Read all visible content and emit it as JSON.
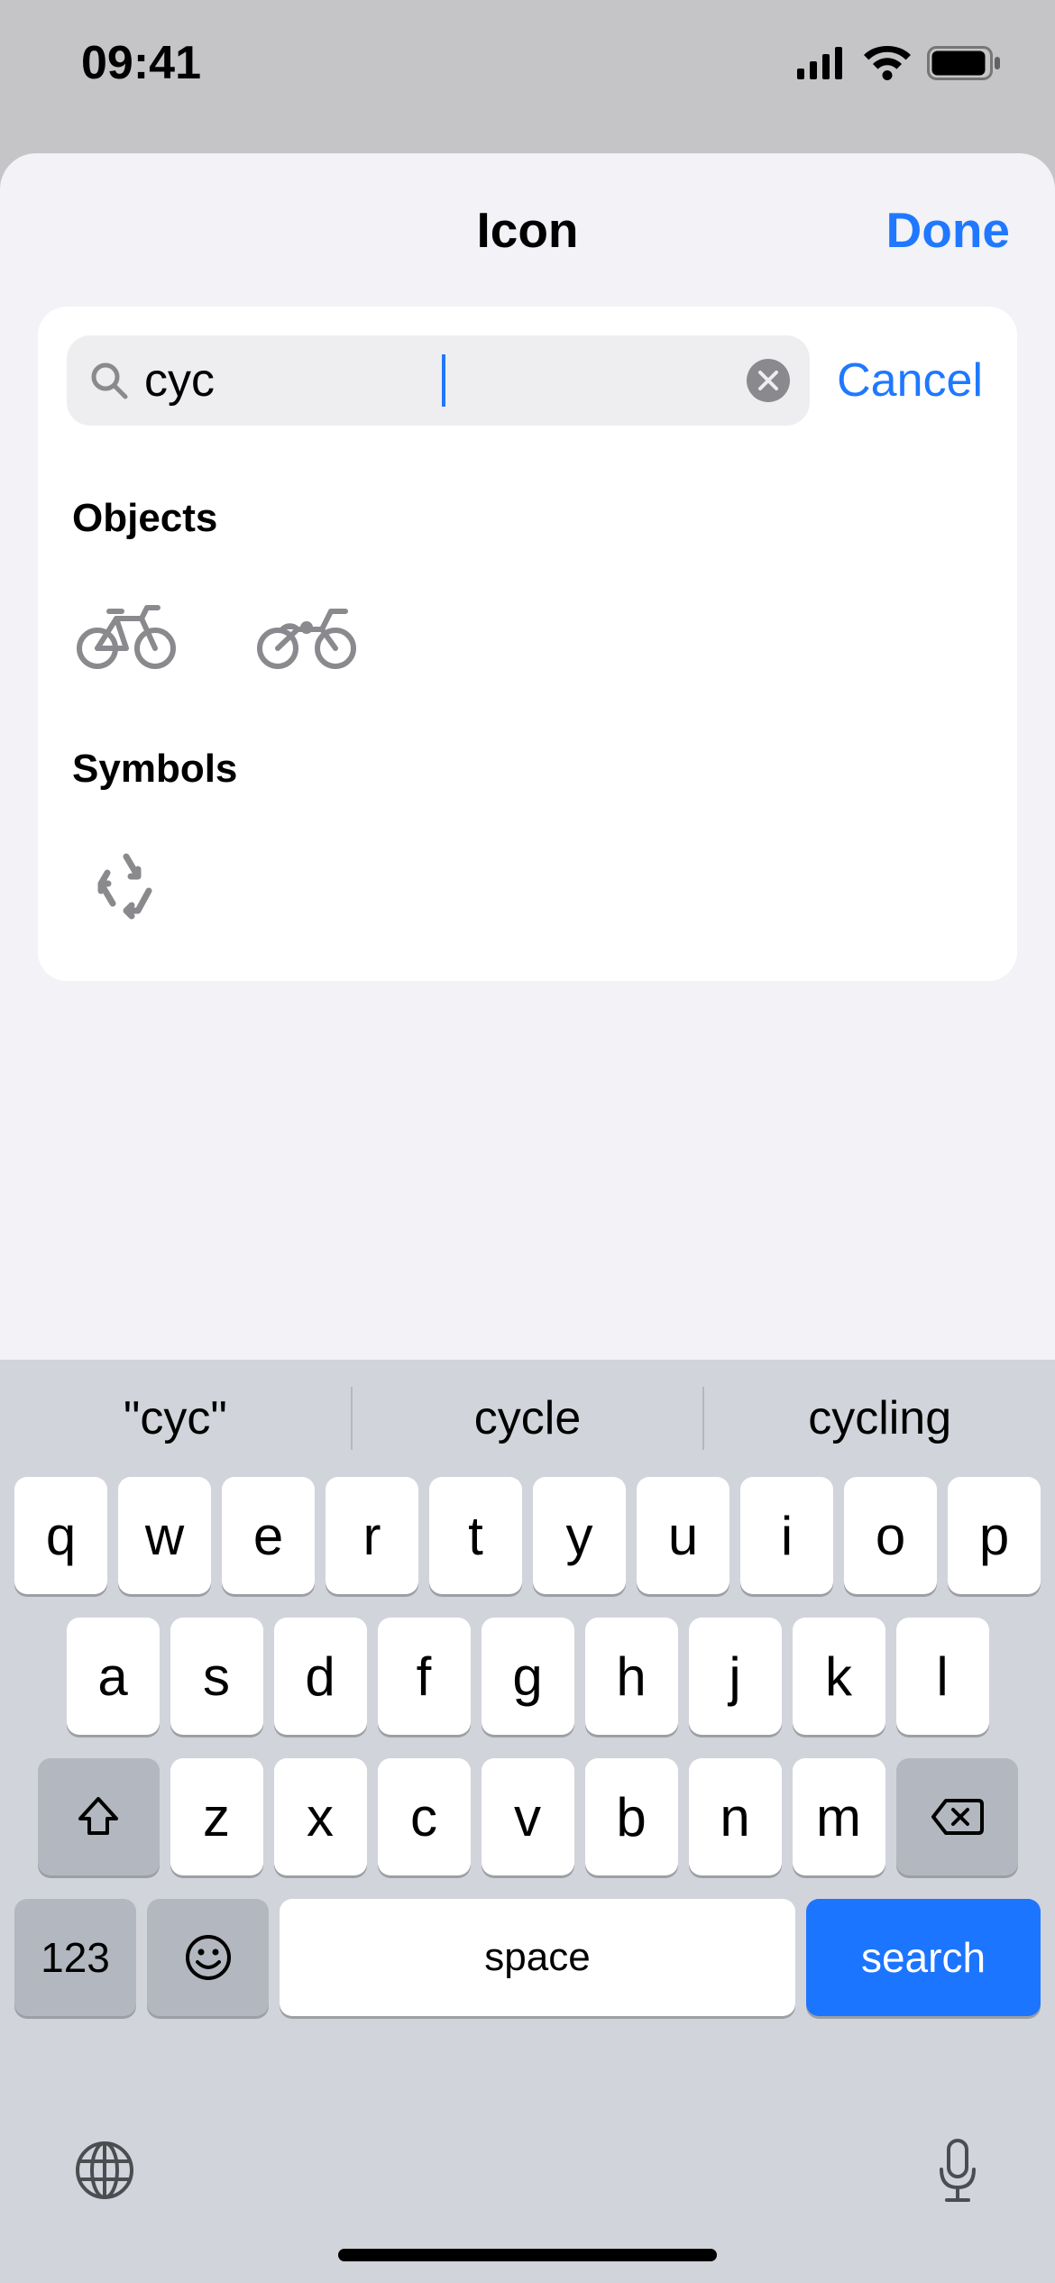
{
  "statusbar": {
    "time": "09:41"
  },
  "sheet": {
    "title": "Icon",
    "done": "Done"
  },
  "search": {
    "value": "cyc",
    "cancel": "Cancel"
  },
  "sections": {
    "objects": {
      "title": "Objects",
      "icons": [
        "bicycle",
        "motorcycle"
      ]
    },
    "symbols": {
      "title": "Symbols",
      "icons": [
        "recycle"
      ]
    }
  },
  "suggestions": [
    "\"cyc\"",
    "cycle",
    "cycling"
  ],
  "keyboard": {
    "row1": [
      "q",
      "w",
      "e",
      "r",
      "t",
      "y",
      "u",
      "i",
      "o",
      "p"
    ],
    "row2": [
      "a",
      "s",
      "d",
      "f",
      "g",
      "h",
      "j",
      "k",
      "l"
    ],
    "row3": [
      "z",
      "x",
      "c",
      "v",
      "b",
      "n",
      "m"
    ],
    "num": "123",
    "space": "space",
    "search": "search"
  }
}
